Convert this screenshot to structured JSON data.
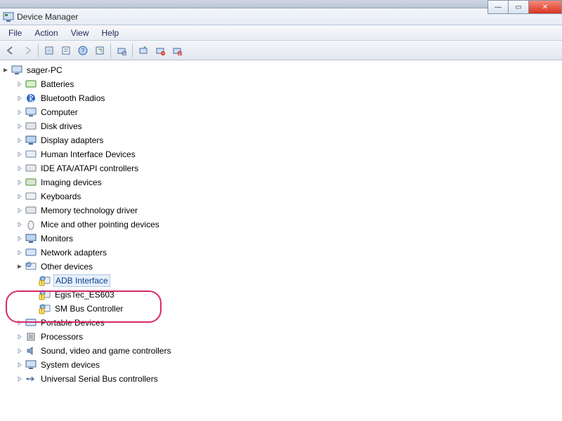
{
  "window": {
    "title": "Device Manager"
  },
  "window_buttons": {
    "min": "—",
    "max": "▭",
    "close": "✕"
  },
  "menu": {
    "file": "File",
    "action": "Action",
    "view": "View",
    "help": "Help"
  },
  "toolbar_icons": [
    "back-icon",
    "forward-icon",
    "sep",
    "properties-icon",
    "refresh-icon",
    "help-icon",
    "sep",
    "scan-icon",
    "sep",
    "update-driver-icon",
    "uninstall-icon",
    "disable-icon"
  ],
  "root": {
    "label": "sager-PC"
  },
  "categories": [
    {
      "label": "Batteries"
    },
    {
      "label": "Bluetooth Radios"
    },
    {
      "label": "Computer"
    },
    {
      "label": "Disk drives"
    },
    {
      "label": "Display adapters"
    },
    {
      "label": "Human Interface Devices"
    },
    {
      "label": "IDE ATA/ATAPI controllers"
    },
    {
      "label": "Imaging devices"
    },
    {
      "label": "Keyboards"
    },
    {
      "label": "Memory technology driver"
    },
    {
      "label": "Mice and other pointing devices"
    },
    {
      "label": "Monitors"
    },
    {
      "label": "Network adapters"
    }
  ],
  "other_devices": {
    "label": "Other devices",
    "children": [
      {
        "label": "ADB Interface",
        "selected": true
      },
      {
        "label": "EgisTec_ES603"
      },
      {
        "label": "SM Bus Controller"
      }
    ]
  },
  "categories_after": [
    {
      "label": "Portable Devices"
    },
    {
      "label": "Processors"
    },
    {
      "label": "Sound, video and game controllers"
    },
    {
      "label": "System devices"
    },
    {
      "label": "Universal Serial Bus controllers"
    }
  ]
}
